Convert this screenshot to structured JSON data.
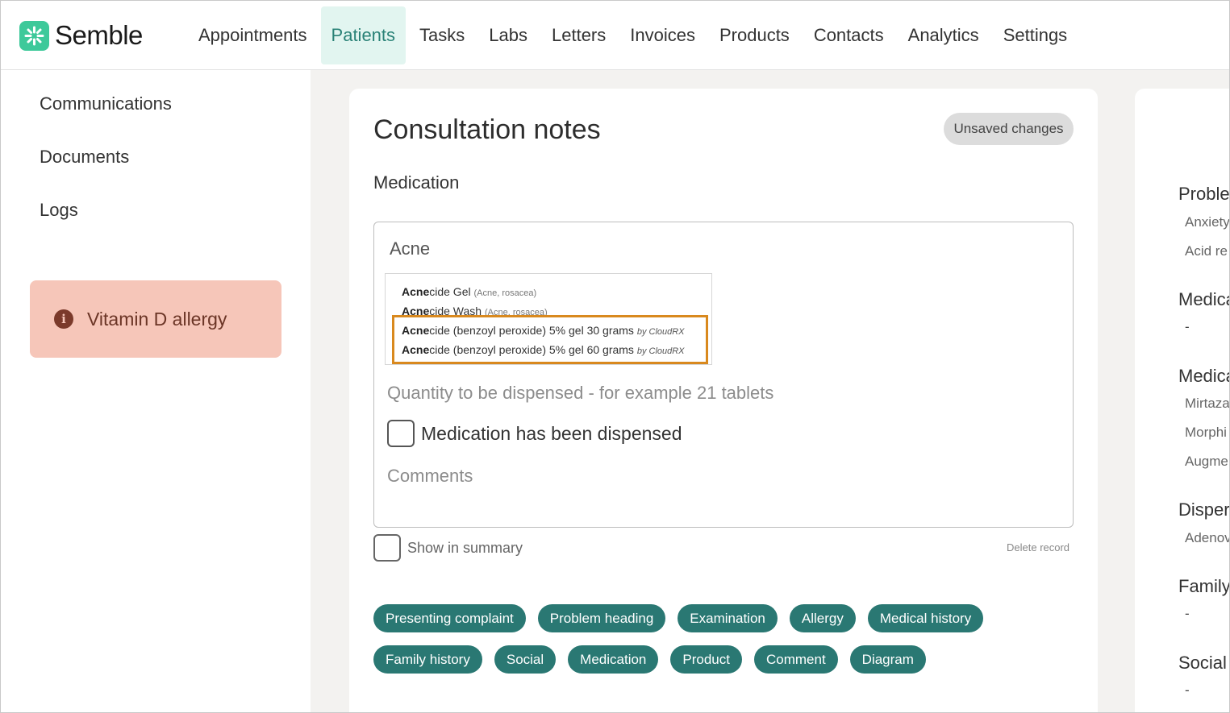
{
  "brand": {
    "name": "Semble",
    "icon": "semble-logo-icon",
    "color": "#3ec99a"
  },
  "nav": {
    "items": [
      {
        "label": "Appointments",
        "active": false
      },
      {
        "label": "Patients",
        "active": true
      },
      {
        "label": "Tasks",
        "active": false
      },
      {
        "label": "Labs",
        "active": false
      },
      {
        "label": "Letters",
        "active": false
      },
      {
        "label": "Invoices",
        "active": false
      },
      {
        "label": "Products",
        "active": false
      },
      {
        "label": "Contacts",
        "active": false
      },
      {
        "label": "Analytics",
        "active": false
      },
      {
        "label": "Settings",
        "active": false
      }
    ]
  },
  "sidebar": {
    "links": [
      "Communications",
      "Documents",
      "Logs"
    ],
    "allergy": {
      "label": "Vitamin D allergy",
      "icon": "info-icon",
      "color": "#f6c6b9"
    }
  },
  "consultation": {
    "title": "Consultation notes",
    "status_badge": "Unsaved changes",
    "section": "Medication",
    "medication_input_value": "Acne",
    "search_highlight": "Acne",
    "dropdown": [
      {
        "rest": "cide Gel",
        "meta": "(Acne, rosacea)",
        "by": ""
      },
      {
        "rest": "cide Wash",
        "meta": "(Acne, rosacea)",
        "by": ""
      },
      {
        "rest": "cide (benzoyl peroxide) 5% gel 30 grams",
        "meta": "",
        "by": "by CloudRX"
      },
      {
        "rest": "cide (benzoyl peroxide) 5% gel 60 grams",
        "meta": "",
        "by": "by CloudRX"
      }
    ],
    "highlight_color": "#d9891e",
    "quantity_placeholder": "Quantity to be dispensed - for example 21 tablets",
    "dispensed_label": "Medication has been dispensed",
    "comments_placeholder": "Comments",
    "show_in_summary_label": "Show in summary",
    "delete_label": "Delete record",
    "chip_color": "#2a7873",
    "chips_row1": [
      "Presenting complaint",
      "Problem heading",
      "Examination",
      "Allergy",
      "Medical history"
    ],
    "chips_row2": [
      "Family history",
      "Social",
      "Medication",
      "Product",
      "Comment",
      "Diagram"
    ]
  },
  "summary_panel": {
    "sections": [
      {
        "heading": "Proble",
        "items": [
          "Anxiety",
          "Acid re"
        ]
      },
      {
        "heading": "Medica",
        "items": [
          "-"
        ]
      },
      {
        "heading": "Medica",
        "items": [
          "Mirtaza",
          "Morphi",
          "Augme"
        ]
      },
      {
        "heading": "Disper",
        "items": [
          "Adenov"
        ]
      },
      {
        "heading": "Family",
        "items": [
          "-"
        ]
      },
      {
        "heading": "Social",
        "items": [
          "-"
        ]
      }
    ]
  }
}
